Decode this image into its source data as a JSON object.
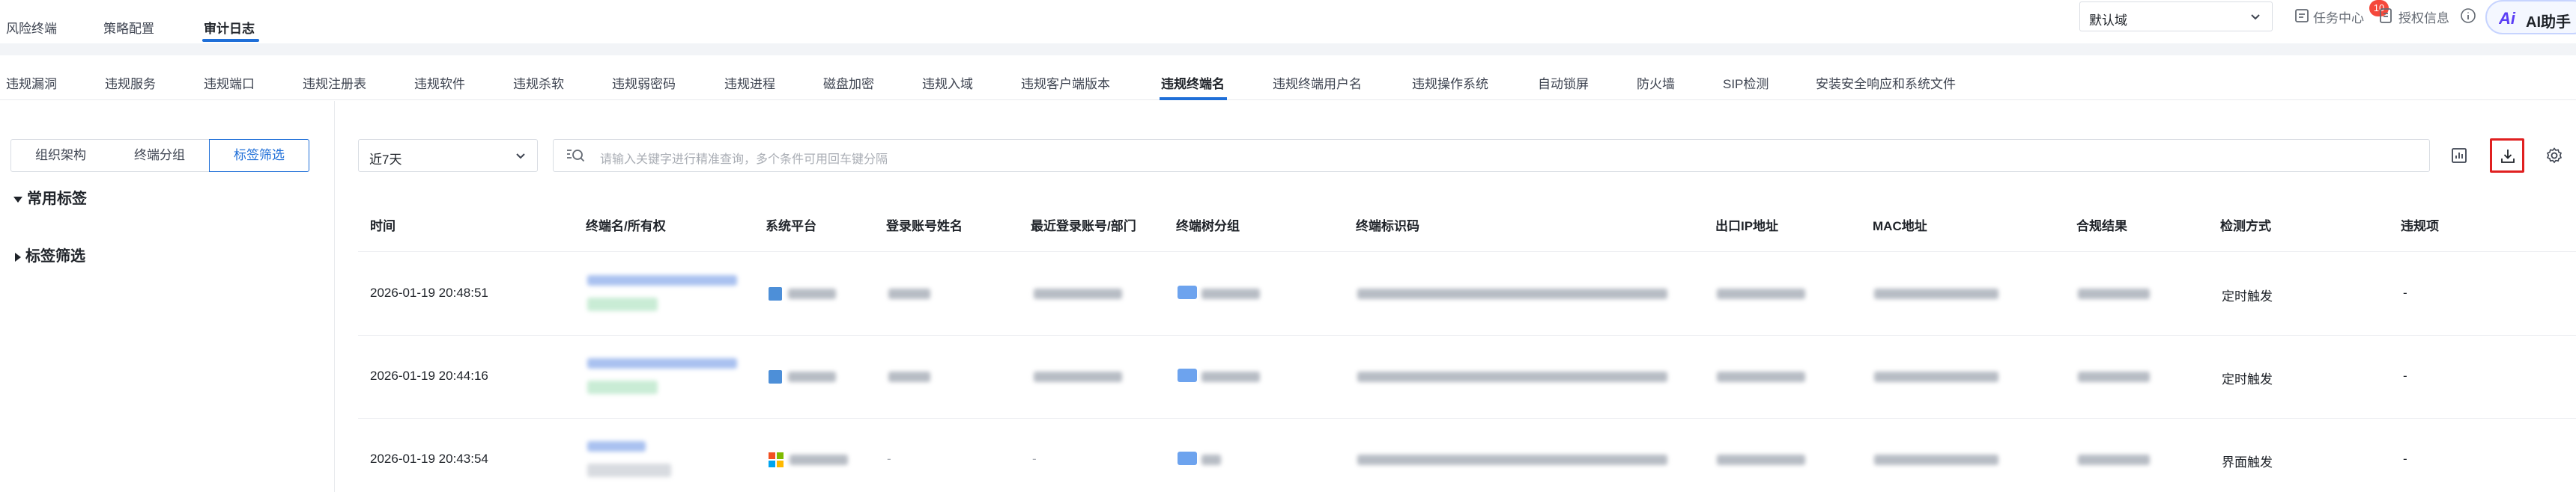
{
  "top_nav": {
    "items": [
      "风险终端",
      "策略配置",
      "审计日志"
    ],
    "active_index": 2
  },
  "header_right": {
    "domain_select": "默认域",
    "task_center": "任务中心",
    "task_badge": "10",
    "license": "授权信息",
    "ai_button": "AI助手"
  },
  "sub_tabs": {
    "items": [
      "违规漏洞",
      "违规服务",
      "违规端口",
      "违规注册表",
      "违规软件",
      "违规杀软",
      "违规弱密码",
      "违规进程",
      "磁盘加密",
      "违规入域",
      "违规客户端版本",
      "违规终端名",
      "违规终端用户名",
      "违规操作系统",
      "自动锁屏",
      "防火墙",
      "SIP检测",
      "安装安全响应和系统文件"
    ],
    "active_index": 11
  },
  "left_panel": {
    "segments": [
      "组织架构",
      "终端分组",
      "标签筛选"
    ],
    "active_segment": 2,
    "tree": [
      "常用标签",
      "标签筛选"
    ]
  },
  "filters": {
    "period": "近7天",
    "search_placeholder": "请输入关键字进行精准查询，多个条件可用回车键分隔"
  },
  "table": {
    "columns": [
      "时间",
      "终端名/所有权",
      "系统平台",
      "登录账号姓名",
      "最近登录账号/部门",
      "终端树分组",
      "终端标识码",
      "出口IP地址",
      "MAC地址",
      "合规结果",
      "检测方式",
      "违规项"
    ],
    "rows": [
      {
        "time": "2026-01-19 20:48:51",
        "detect": "定时触发",
        "violation": "-"
      },
      {
        "time": "2026-01-19 20:44:16",
        "detect": "定时触发",
        "violation": "-"
      },
      {
        "time": "2026-01-19 20:43:54",
        "login_name": "-",
        "recent_account": "-",
        "detect": "界面触发",
        "violation": "-"
      }
    ]
  },
  "colors": {
    "accent": "#1f6fd8",
    "highlight_box": "#e02020",
    "badge": "#f5483b"
  }
}
